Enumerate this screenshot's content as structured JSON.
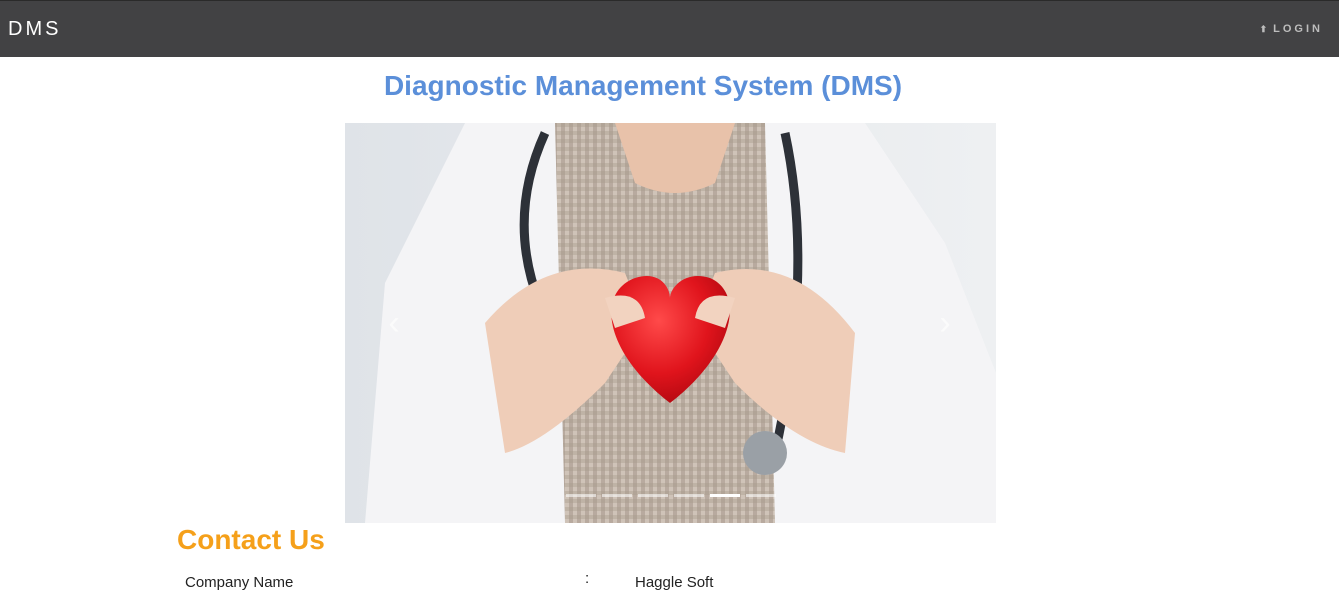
{
  "navbar": {
    "brand": "DMS",
    "login_label": "LOGIN",
    "login_icon": "login-arrow-icon"
  },
  "main": {
    "title": "Diagnostic Management System (DMS)",
    "carousel": {
      "image_description_icon": "doctor-heart-image",
      "prev_icon": "chevron-left-icon",
      "next_icon": "chevron-right-icon",
      "slide_count": 6,
      "active_slide": 5
    }
  },
  "contact": {
    "heading": "Contact Us",
    "rows": [
      {
        "label": "Company Name",
        "separator": ":",
        "value": "Haggle Soft"
      }
    ]
  },
  "colors": {
    "navbar": "#424244",
    "title": "#5b8fd9",
    "contact_heading": "#f5a01a"
  }
}
